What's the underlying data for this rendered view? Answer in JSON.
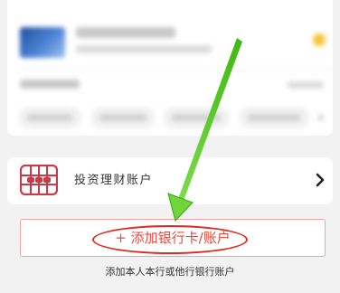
{
  "investment": {
    "label": "投资理财账户",
    "icon": "abacus-icon"
  },
  "add_account": {
    "button_label": "+ 添加银行卡/账户",
    "hint": "添加本人本行或他行银行账户"
  },
  "colors": {
    "accent_red": "#e84a3c",
    "highlight_circle": "#e02a1f",
    "annotation_arrow": "#4cc21f"
  }
}
